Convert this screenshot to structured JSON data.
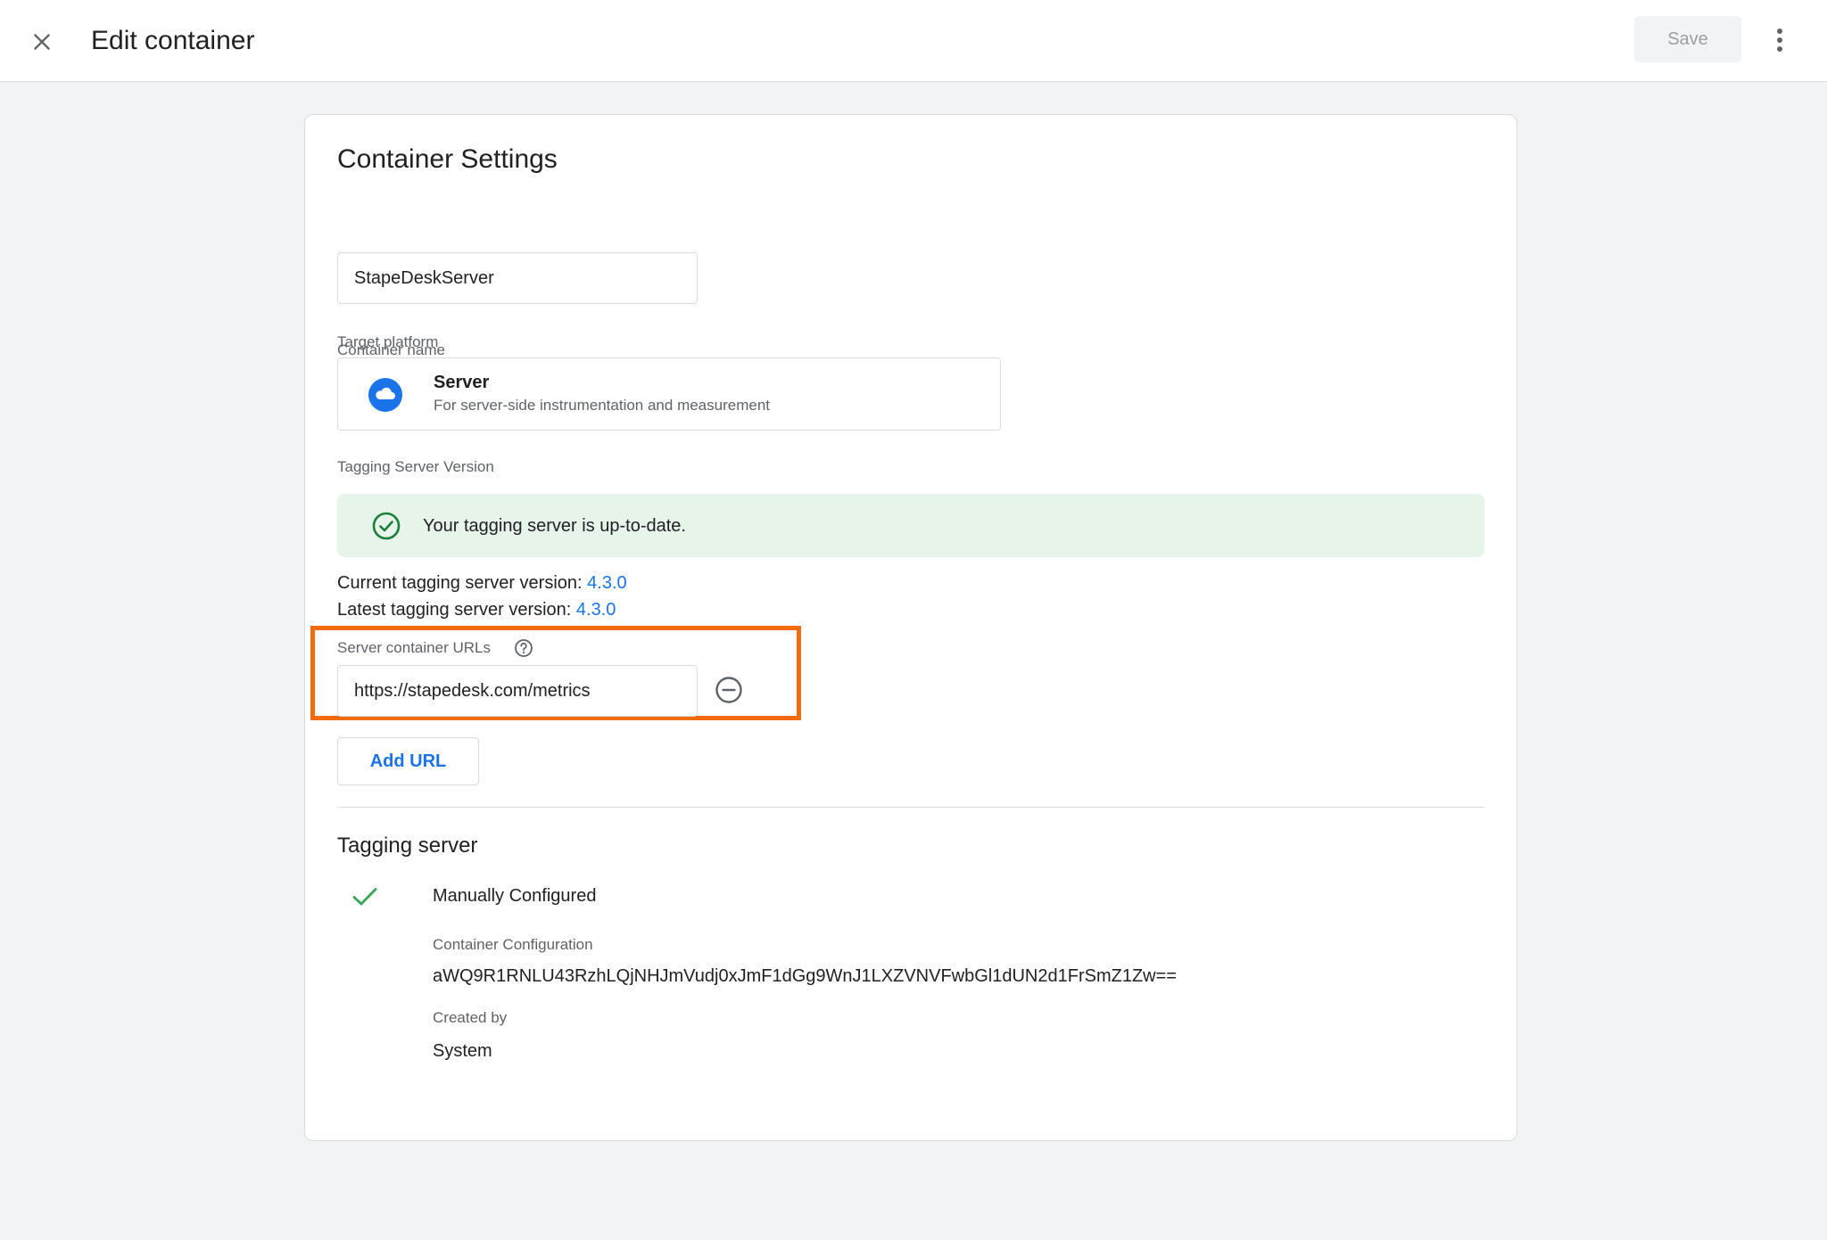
{
  "header": {
    "title": "Edit container",
    "save_label": "Save"
  },
  "card": {
    "title": "Container Settings",
    "container_name": {
      "label": "Container name",
      "value": "StapeDeskServer"
    },
    "target_platform": {
      "label": "Target platform",
      "name": "Server",
      "description": "For server-side instrumentation and measurement",
      "icon": "cloud-icon"
    },
    "tagging_server_version": {
      "label": "Tagging Server Version",
      "status_message": "Your tagging server is up-to-date.",
      "current_label": "Current tagging server version: ",
      "current_value": "4.3.0",
      "latest_label": "Latest tagging server version: ",
      "latest_value": "4.3.0"
    },
    "server_container_urls": {
      "label": "Server container URLs",
      "urls": [
        "https://stapedesk.com/metrics"
      ],
      "add_url_label": "Add URL"
    },
    "tagging_server": {
      "title": "Tagging server",
      "mode": "Manually Configured",
      "config_label": "Container Configuration",
      "config_value": "aWQ9R1RNLU43RzhLQjNHJmVudj0xJmF1dGg9WnJ1LXZVNVFwbGl1dUN2d1FrSmZ1Zw==",
      "created_by_label": "Created by",
      "created_by_value": "System"
    }
  },
  "colors": {
    "accent": "#1a73e8",
    "highlight": "#f26b0f",
    "success_bg": "#e6f4ea",
    "success": "#188038",
    "background": "#f1f3f4"
  }
}
